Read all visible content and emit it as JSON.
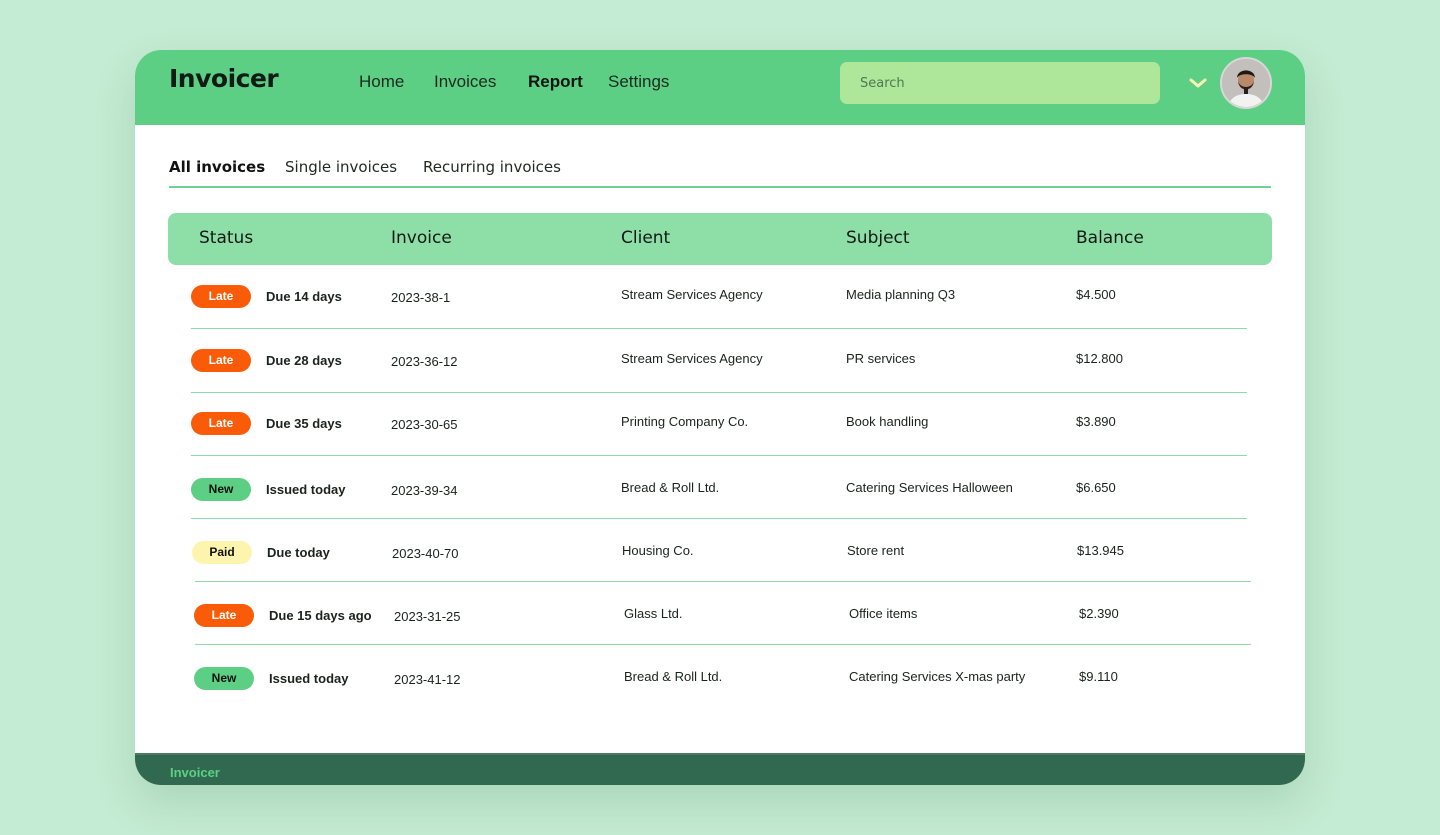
{
  "app": {
    "title": "Invoicer"
  },
  "nav": {
    "items": [
      {
        "label": "Home",
        "active": false
      },
      {
        "label": "Invoices",
        "active": false
      },
      {
        "label": "Report",
        "active": true
      },
      {
        "label": "Settings",
        "active": false
      }
    ]
  },
  "search": {
    "placeholder": "Search",
    "value": ""
  },
  "user": {
    "menu_icon": "chevron-down-icon",
    "avatar": "user-avatar"
  },
  "tabs": [
    {
      "label": "All invoices",
      "active": true
    },
    {
      "label": "Single invoices",
      "active": false
    },
    {
      "label": "Recurring invoices",
      "active": false
    }
  ],
  "table": {
    "columns": [
      "Status",
      "Invoice",
      "Client",
      "Subject",
      "Balance"
    ],
    "rows": [
      {
        "status": "Late",
        "due": "Due 14 days",
        "invoice": "2023-38-1",
        "client": "Stream Services Agency",
        "subject": "Media planning Q3",
        "balance": "$4.500"
      },
      {
        "status": "Late",
        "due": "Due 28 days",
        "invoice": "2023-36-12",
        "client": "Stream Services Agency",
        "subject": "PR services",
        "balance": "$12.800"
      },
      {
        "status": "Late",
        "due": "Due 35 days",
        "invoice": "2023-30-65",
        "client": "Printing Company Co.",
        "subject": "Book handling",
        "balance": "$3.890"
      },
      {
        "status": "New",
        "due": "Issued today",
        "invoice": "2023-39-34",
        "client": "Bread & Roll Ltd.",
        "subject": "Catering Services Halloween",
        "balance": "$6.650"
      },
      {
        "status": "Paid",
        "due": "Due today",
        "invoice": "2023-40-70",
        "client": "Housing Co.",
        "subject": "Store rent",
        "balance": "$13.945"
      },
      {
        "status": "Late",
        "due": "Due 15 days ago",
        "invoice": "2023-31-25",
        "client": "Glass Ltd.",
        "subject": "Office items",
        "balance": "$2.390"
      },
      {
        "status": "New",
        "due": "Issued today",
        "invoice": "2023-41-12",
        "client": "Bread & Roll Ltd.",
        "subject": "Catering Services X-mas party",
        "balance": "$9.110"
      }
    ]
  },
  "footer": {
    "logo": "Invoicer"
  },
  "colors": {
    "brand_green": "#5ccf85",
    "header_row": "#8edea8",
    "late": "#fa5b08",
    "new": "#5ccf85",
    "paid": "#fdf5ae",
    "footer": "#316950",
    "search_bg": "#aee69a",
    "nav_highlight": "#fdf4b3"
  }
}
